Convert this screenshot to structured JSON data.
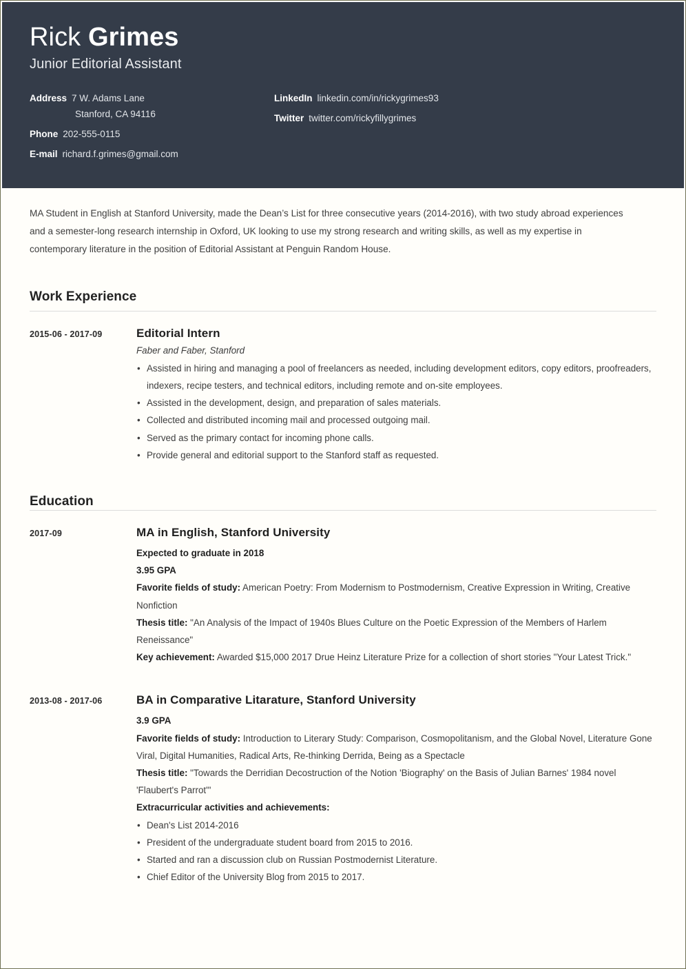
{
  "header": {
    "first_name": "Rick",
    "last_name": "Grimes",
    "job_title": "Junior Editorial Assistant",
    "contacts_left": [
      {
        "label": "Address",
        "value": "7 W. Adams Lane",
        "sub": "Stanford, CA 94116"
      },
      {
        "label": "Phone",
        "value": "202-555-0115"
      },
      {
        "label": "E-mail",
        "value": "richard.f.grimes@gmail.com"
      }
    ],
    "contacts_right": [
      {
        "label": "LinkedIn",
        "value": "linkedin.com/in/rickygrimes93"
      },
      {
        "label": "Twitter",
        "value": "twitter.com/rickyfillygrimes"
      }
    ],
    "background_color": "#343c49",
    "text_color": "#ffffff"
  },
  "summary": "MA Student in English at Stanford University, made the Dean’s List for three consecutive years (2014-2016), with two study abroad experiences and a semester-long research internship in Oxford, UK looking to use my strong research and writing skills, as well as my expertise in contemporary literature in the position of Editorial Assistant at Penguin Random House.",
  "sections": {
    "work": {
      "title": "Work Experience",
      "entries": [
        {
          "date": "2015-06 - 2017-09",
          "title": "Editorial Intern",
          "subtitle": "Faber and Faber, Stanford",
          "bullets": [
            "Assisted in hiring and managing a pool of freelancers as needed, including development editors, copy editors, proofreaders, indexers, recipe testers, and technical editors, including remote and on-site employees.",
            "Assisted in the development, design, and preparation of sales materials.",
            "Collected and distributed incoming mail and processed outgoing mail.",
            "Served as the primary contact for incoming phone calls.",
            "Provide general and editorial support to the Stanford staff as requested."
          ]
        }
      ]
    },
    "education": {
      "title": "Education",
      "entries": [
        {
          "date": "2017-09",
          "title": "MA in English, Stanford University",
          "line_expected": "Expected to graduate in 2018",
          "line_gpa": "3.95 GPA",
          "fields_label": "Favorite fields of study:",
          "fields_value": " American Poetry: From Modernism to Postmodernism, Creative Expression in Writing, Creative Nonfiction",
          "thesis_label": "Thesis title:",
          "thesis_value": " \"An Analysis of the Impact of 1940s Blues Culture on the Poetic Expression of the Members of Harlem Reneissance\"",
          "achievement_label": "Key achievement:",
          "achievement_value": " Awarded $15,000 2017 Drue Heinz Literature Prize for a collection of short stories \"Your Latest Trick.\""
        },
        {
          "date": "2013-08 - 2017-06",
          "title": "BA in Comparative Litarature, Stanford University",
          "line_gpa": "3.9 GPA",
          "fields_label": "Favorite fields of study:",
          "fields_value": " Introduction to Literary Study: Comparison, Cosmopolitanism, and the Global Novel, Literature Gone Viral, Digital Humanities, Radical Arts, Re-thinking Derrida, Being as a Spectacle",
          "thesis_label": "Thesis title:",
          "thesis_value": " \"Towards the Derridian Decostruction of the Notion 'Biography' on the Basis of Julian Barnes' 1984 novel 'Flaubert's Parrot'\"",
          "extra_label": "Extracurricular activities and achievements:",
          "extra_bullets": [
            "Dean's List 2014-2016",
            "President of the undergraduate student board from 2015 to 2016.",
            "Started and ran a discussion club on Russian Postmodernist Literature.",
            "Chief Editor of the University Blog from 2015 to 2017."
          ]
        }
      ]
    }
  }
}
